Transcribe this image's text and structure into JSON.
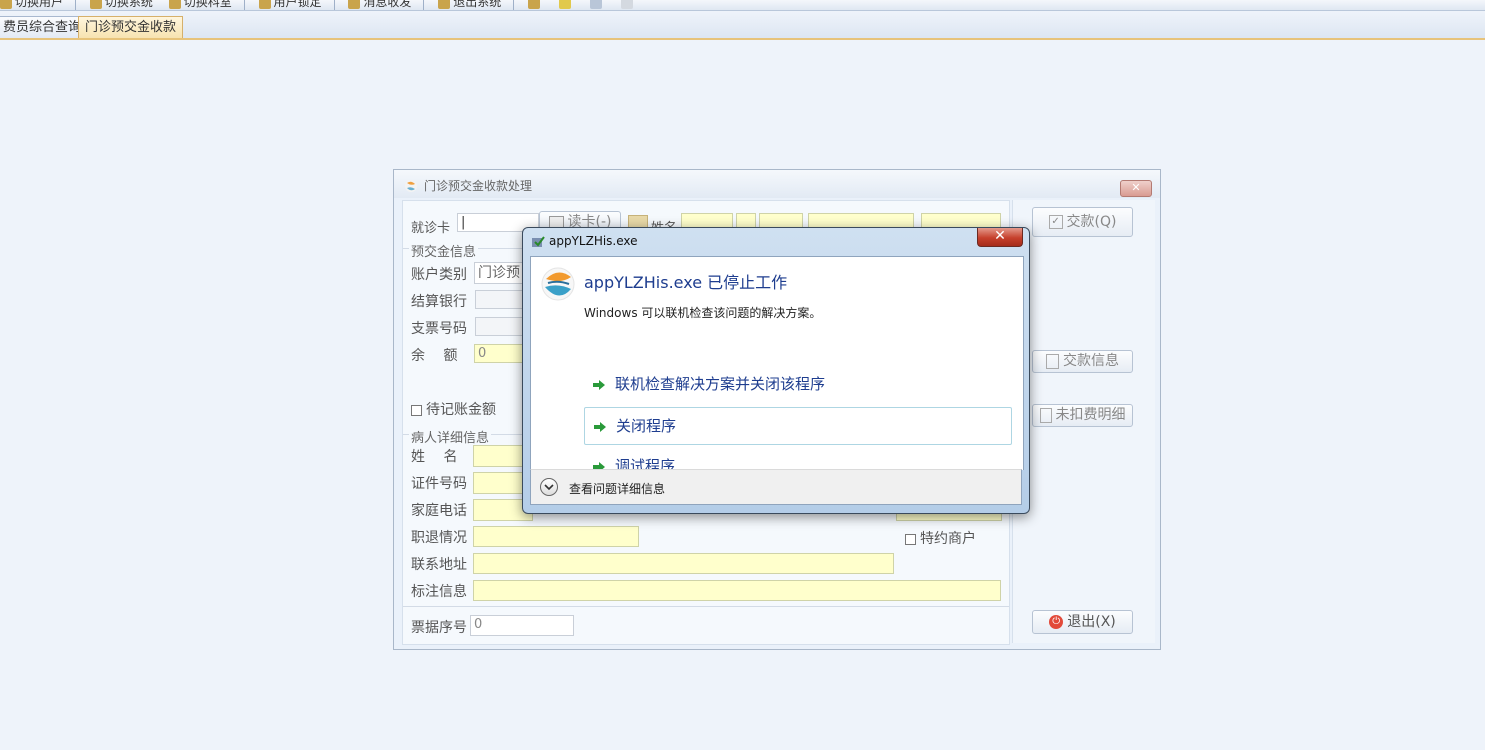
{
  "toolbar": {
    "items": [
      "切换用户",
      "切换系统",
      "切换科室",
      "用户锁定",
      "消息收发",
      "退出系统"
    ]
  },
  "tabs": [
    {
      "label": "费员综合查询",
      "active": false
    },
    {
      "label": "门诊预交金收款",
      "active": true
    }
  ],
  "form": {
    "title": "门诊预交金收款处理",
    "card_label": "就诊卡",
    "read_card_button": "读卡(-)",
    "name_label": "姓名",
    "prepay_group": "预交金信息",
    "account_type_label": "账户类别",
    "account_type_value": "门诊预",
    "bank_label": "结算银行",
    "check_no_label": "支票号码",
    "balance_label": "余　 额",
    "balance_value": "0",
    "pending_label": "待记账金额",
    "patient_group": "病人详细信息",
    "patient_name_label": "姓　 名",
    "id_no_label": "证件号码",
    "home_phone_label": "家庭电话",
    "retire_label": "职退情况",
    "special_merchant_label": "特约商户",
    "address_label": "联系地址",
    "note_label": "标注信息",
    "receipt_no_label": "票据序号",
    "receipt_no_value": "0",
    "pay_button": "交款(Q)",
    "pay_info_button": "交款信息",
    "uncharged_button": "未扣费明细",
    "exit_button": "退出(X)"
  },
  "dialog": {
    "title": "appYLZHis.exe",
    "close_glyph": "✕",
    "heading": "appYLZHis.exe 已停止工作",
    "description": "Windows 可以联机检查该问题的解决方案。",
    "options": [
      "联机检查解决方案并关闭该程序",
      "关闭程序",
      "调试程序"
    ],
    "details": "查看问题详细信息"
  }
}
